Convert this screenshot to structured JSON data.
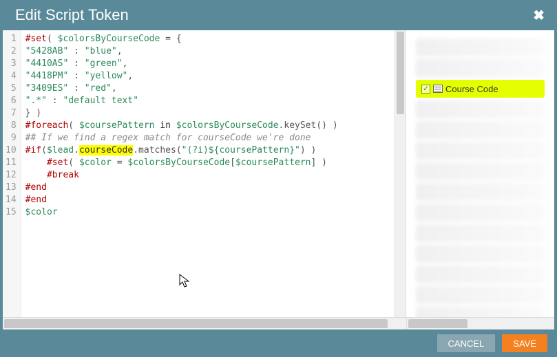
{
  "dialog": {
    "title": "Edit Script Token",
    "close_glyph": "✖"
  },
  "editor": {
    "lines": [
      [
        {
          "t": "#set",
          "c": "kw"
        },
        {
          "t": "( ",
          "c": "punct"
        },
        {
          "t": "$colorsByCourseCode",
          "c": "var"
        },
        {
          "t": " = {",
          "c": "punct"
        }
      ],
      [
        {
          "t": "\"5428AB\"",
          "c": "str"
        },
        {
          "t": " : ",
          "c": "punct"
        },
        {
          "t": "\"blue\"",
          "c": "str"
        },
        {
          "t": ",",
          "c": "punct"
        }
      ],
      [
        {
          "t": "\"4410AS\"",
          "c": "str"
        },
        {
          "t": " : ",
          "c": "punct"
        },
        {
          "t": "\"green\"",
          "c": "str"
        },
        {
          "t": ",",
          "c": "punct"
        }
      ],
      [
        {
          "t": "\"4418PM\"",
          "c": "str"
        },
        {
          "t": " : ",
          "c": "punct"
        },
        {
          "t": "\"yellow\"",
          "c": "str"
        },
        {
          "t": ",",
          "c": "punct"
        }
      ],
      [
        {
          "t": "\"3409ES\"",
          "c": "str"
        },
        {
          "t": " : ",
          "c": "punct"
        },
        {
          "t": "\"red\"",
          "c": "str"
        },
        {
          "t": ",",
          "c": "punct"
        }
      ],
      [
        {
          "t": "\".*\"",
          "c": "str"
        },
        {
          "t": " : ",
          "c": "punct"
        },
        {
          "t": "\"default text\"",
          "c": "str"
        }
      ],
      [
        {
          "t": "} )",
          "c": "punct"
        }
      ],
      [
        {
          "t": "#foreach",
          "c": "kw"
        },
        {
          "t": "( ",
          "c": "punct"
        },
        {
          "t": "$coursePattern",
          "c": "var"
        },
        {
          "t": " in ",
          "c": "txt"
        },
        {
          "t": "$colorsByCourseCode",
          "c": "var"
        },
        {
          "t": ".keySet() )",
          "c": "punct"
        }
      ],
      [
        {
          "t": "## If we find a regex match for courseCode we're done",
          "c": "cmt"
        }
      ],
      [
        {
          "t": "#if",
          "c": "kw"
        },
        {
          "t": "(",
          "c": "punct"
        },
        {
          "t": "$lead",
          "c": "var"
        },
        {
          "t": ".",
          "c": "punct"
        },
        {
          "t": "courseCode",
          "c": "txt",
          "hl": true
        },
        {
          "t": ".matches(",
          "c": "punct"
        },
        {
          "t": "\"(?i)${coursePattern}\"",
          "c": "str"
        },
        {
          "t": ") )",
          "c": "punct"
        }
      ],
      [
        {
          "t": "    ",
          "c": "txt"
        },
        {
          "t": "#set",
          "c": "kw"
        },
        {
          "t": "( ",
          "c": "punct"
        },
        {
          "t": "$color",
          "c": "var"
        },
        {
          "t": " = ",
          "c": "punct"
        },
        {
          "t": "$colorsByCourseCode",
          "c": "var"
        },
        {
          "t": "[",
          "c": "punct"
        },
        {
          "t": "$coursePattern",
          "c": "var"
        },
        {
          "t": "] )",
          "c": "punct"
        }
      ],
      [
        {
          "t": "    ",
          "c": "txt"
        },
        {
          "t": "#break",
          "c": "kw"
        }
      ],
      [
        {
          "t": "#end",
          "c": "kw"
        }
      ],
      [
        {
          "t": "#end",
          "c": "kw"
        }
      ],
      [
        {
          "t": "$color",
          "c": "var"
        }
      ]
    ]
  },
  "side": {
    "highlight_label": "Course Code",
    "check_glyph": "✓",
    "blur_count_before": 2,
    "blur_count_after": 12
  },
  "footer": {
    "cancel_label": "CANCEL",
    "save_label": "SAVE"
  }
}
